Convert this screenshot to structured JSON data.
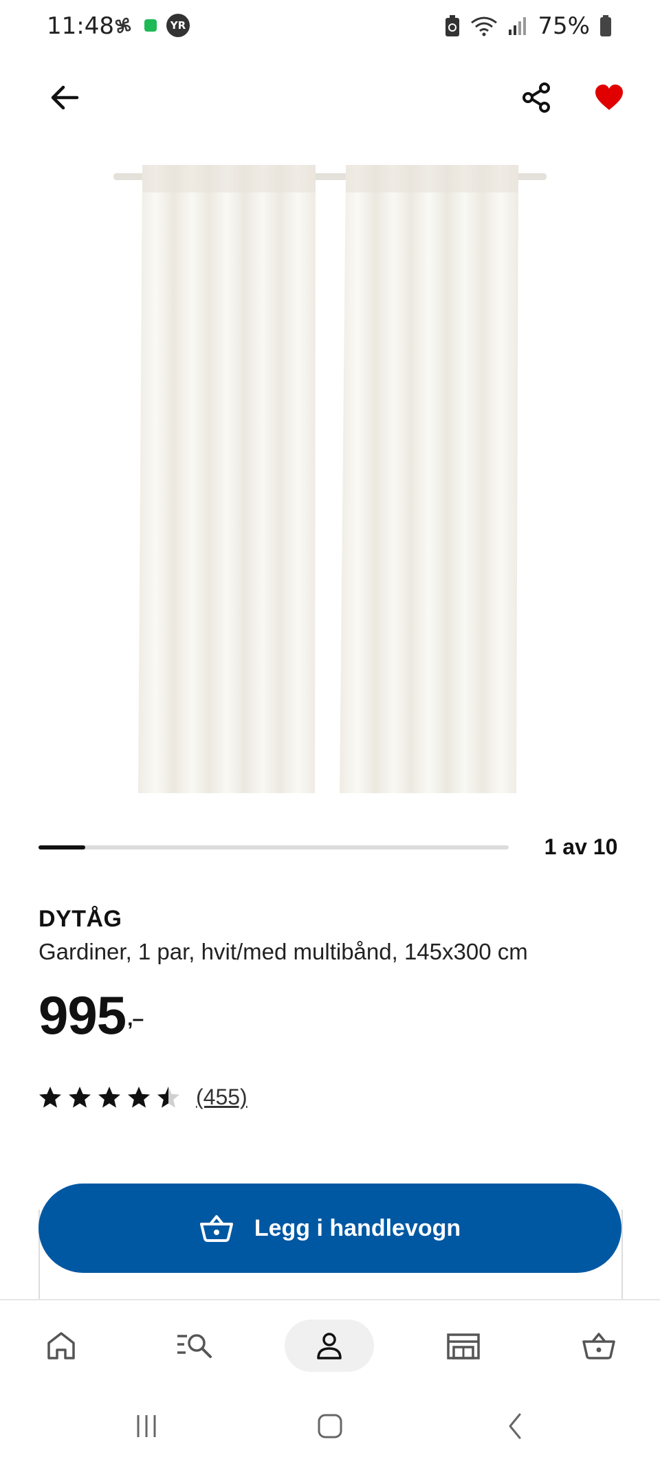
{
  "status_bar": {
    "time": "11:48",
    "yr_badge": "YR",
    "battery": "75%"
  },
  "gallery": {
    "counter": "1 av 10",
    "current": 1,
    "total": 10
  },
  "product": {
    "name": "DYTÅG",
    "description": "Gardiner, 1 par, hvit/med multibånd, 145x300 cm",
    "price": "995",
    "price_suffix": ",–",
    "rating": 4.5,
    "review_count": "(455)"
  },
  "actions": {
    "add_to_cart": "Legg i handlevogn"
  },
  "bottom_nav": {
    "items": [
      "home-icon",
      "search-icon",
      "profile-icon",
      "store-icon",
      "cart-icon"
    ],
    "active": "profile-icon"
  },
  "colors": {
    "brand_blue": "#0058a3",
    "favorite_red": "#e00000"
  }
}
